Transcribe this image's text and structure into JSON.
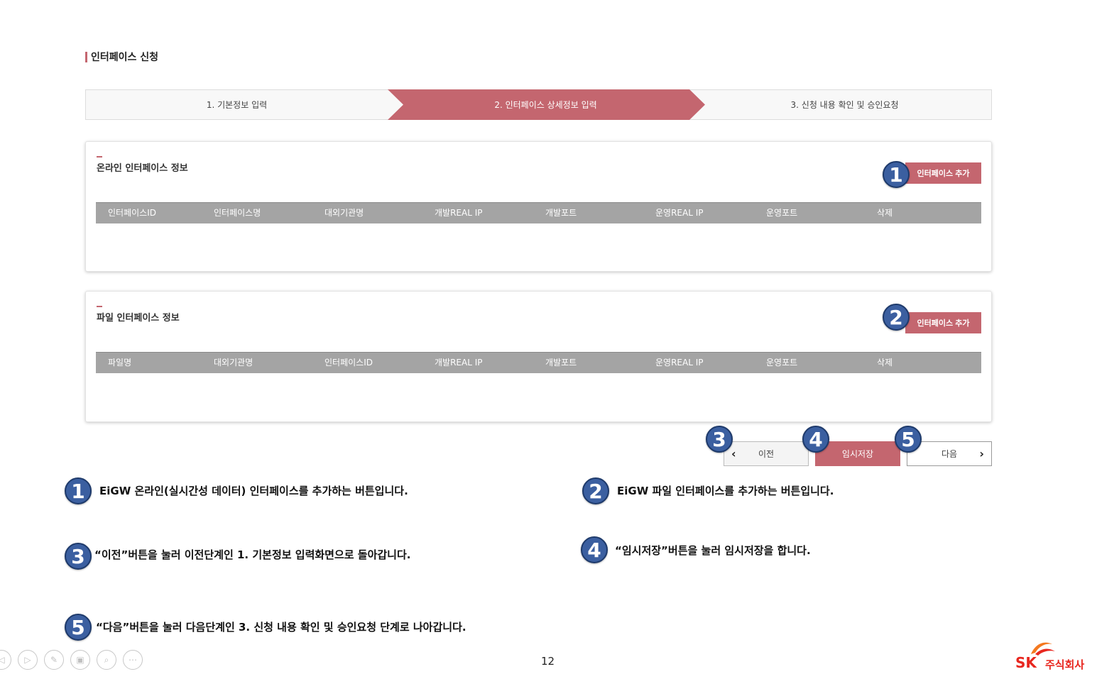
{
  "page_title": "인터페이스 신청",
  "stepper": {
    "steps": [
      {
        "label": "1. 기본정보 입력",
        "active": false
      },
      {
        "label": "2. 인터페이스 상세정보 입력",
        "active": true
      },
      {
        "label": "3. 신청 내용 확인 및 승인요청",
        "active": false
      }
    ]
  },
  "online_panel": {
    "title": "온라인 인터페이스 정보",
    "add_label": "인터페이스 추가",
    "columns": [
      "인터페이스ID",
      "인터페이스명",
      "대외기관명",
      "개발REAL IP",
      "개발포트",
      "운영REAL IP",
      "운영포트",
      "삭제"
    ]
  },
  "file_panel": {
    "title": "파일 인터페이스 정보",
    "add_label": "인터페이스 추가",
    "columns": [
      "파일명",
      "대외기관명",
      "인터페이스ID",
      "개발REAL IP",
      "개발포트",
      "운영REAL IP",
      "운영포트",
      "삭제"
    ]
  },
  "buttons": {
    "prev": "이전",
    "save": "임시저장",
    "next": "다음"
  },
  "badges": [
    "1",
    "2",
    "3",
    "4",
    "5"
  ],
  "descriptions": {
    "d1": "EiGW 온라인(실시간성 데이터) 인터페이스를 추가하는 버튼입니다.",
    "d2": "EiGW 파일 인터페이스를 추가하는 버튼입니다.",
    "d3": "“이전”버튼을 눌러 이전단계인 1. 기본정보 입력화면으로 돌아갑니다.",
    "d4": "“임시저장”버튼을 눌러 임시저장을 합니다.",
    "d5": "“다음”버튼을 눌러 다음단계인 3. 신청 내용 확인 및 승인요청 단계로 나아갑니다."
  },
  "page_number": "12",
  "logo": {
    "brand": "SK",
    "company": "주식회사"
  },
  "colors": {
    "accent": "#c4666f",
    "badge": "#3b5fa0",
    "header_gray": "#a4a4a4"
  },
  "toolbar_icons": [
    "arrow-left-icon",
    "play-icon",
    "pen-icon",
    "slides-icon",
    "zoom-icon",
    "more-icon"
  ]
}
